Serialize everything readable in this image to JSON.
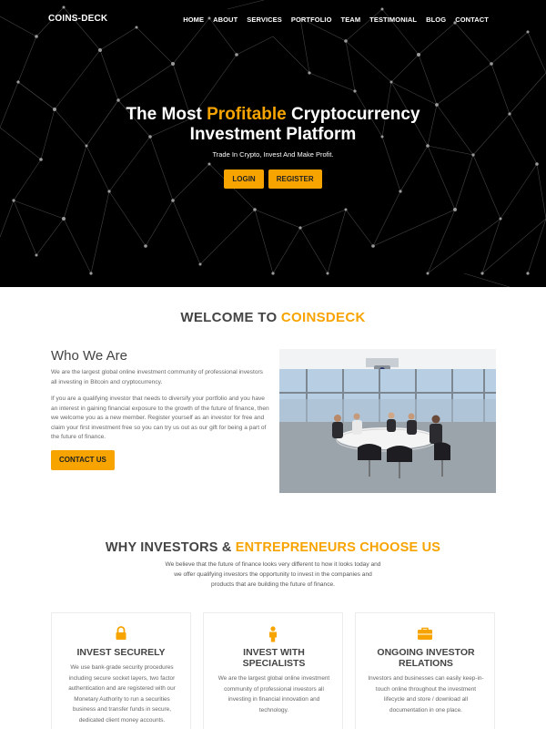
{
  "nav": {
    "logo": "COINS-DECK",
    "items": [
      "HOME",
      "ABOUT",
      "SERVICES",
      "PORTFOLIO",
      "TEAM",
      "TESTIMONIAL",
      "BLOG",
      "CONTACT"
    ]
  },
  "hero": {
    "title_part1": "The Most ",
    "title_accent": "Profitable",
    "title_part2": " Cryptocurrency",
    "title_line2": "Investment Platform",
    "subtitle": "Trade In Crypto, Invest And Make Profit.",
    "login_label": "LOGIN",
    "register_label": "REGISTER"
  },
  "welcome": {
    "title_part1": "WELCOME TO ",
    "title_accent": "COINSDECK",
    "who_title": "Who We Are",
    "para1": "We are the largest global online investment community of professional investors all investing in Bitcoin and cryptocurrency.",
    "para2": "If you are a qualifying investor that needs to diversify your portfolio and you have an interest in gaining financial exposure to the growth of the future of finance, then we welcome you as a new member. Register yourself as an investor for free and claim your first investment free so you can try us out as our gift for being a part of the future of finance.",
    "contact_label": "CONTACT US"
  },
  "why": {
    "title_part1": "WHY INVESTORS & ",
    "title_accent": "ENTREPRENEURS CHOOSE US",
    "text": "We believe that the future of finance looks very different to how it looks today and we offer qualifying investors the opportunity to invest in the companies and products that are building the future of finance."
  },
  "cards": [
    {
      "icon": "lock-icon",
      "title": "INVEST SECURELY",
      "text": "We use bank-grade security procedures including secure socket layers, two factor authentication and are registered with our Monetary Authority to run a securities business and transfer funds in secure, dedicated client money accounts."
    },
    {
      "icon": "person-icon",
      "title": "INVEST WITH SPECIALISTS",
      "text": "We are the largest global online investment community of professional investors all investing in financial innovation and technology."
    },
    {
      "icon": "briefcase-icon",
      "title": "ONGOING INVESTOR RELATIONS",
      "text": "Investors and businesses can easily keep-in-touch online throughout the investment lifecycle and store / download all documentation in one place."
    }
  ],
  "colors": {
    "accent": "#f7a400",
    "hero_bg": "#000000",
    "text_dark": "#444444"
  }
}
